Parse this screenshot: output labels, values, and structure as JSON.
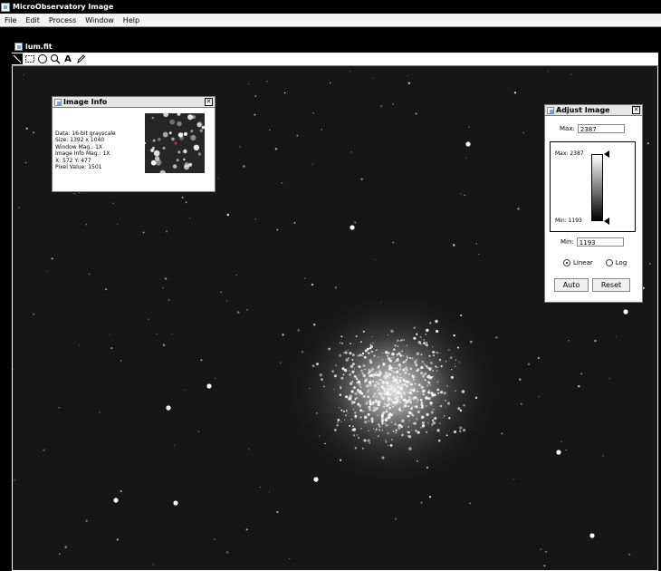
{
  "app": {
    "title": "MicroObservatory Image",
    "menu": [
      "File",
      "Edit",
      "Process",
      "Window",
      "Help"
    ]
  },
  "document": {
    "title": "lum.fit",
    "tools": [
      "line-tool-icon",
      "rect-select-icon",
      "ellipse-select-icon",
      "zoom-icon",
      "text-tool-icon",
      "pencil-icon"
    ]
  },
  "image_info": {
    "title": "Image Info",
    "lines": [
      "Data: 16-bit grayscale",
      "Size: 1392 x 1040",
      "Window Mag.: 1X",
      "Image Info Mag.: 1X",
      "X: 572  Y: 477",
      "Pixel Value: 1501"
    ]
  },
  "adjust_image": {
    "title": "Adjust Image",
    "max_label": "Max:",
    "max_value": "2387",
    "hist_max_label": "Max: 2387",
    "hist_min_label": "Min: 1193",
    "min_label": "Min:",
    "min_value": "1193",
    "scale_options": [
      "Linear",
      "Log"
    ],
    "selected_scale": "Linear",
    "auto_button": "Auto",
    "reset_button": "Reset"
  },
  "colors": {
    "sky": "#161616",
    "titlebar": "#000000",
    "menubar": "#f2f2f2"
  }
}
